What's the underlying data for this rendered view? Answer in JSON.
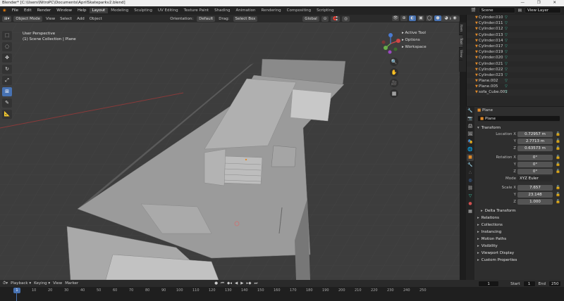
{
  "titlebar": {
    "title": "Blender* [C:\\Users\\NitroPC\\Documents\\AprilSkateparkv2.blend]",
    "controls": "— ❐ ✕"
  },
  "menu": {
    "items": [
      "File",
      "Edit",
      "Render",
      "Window",
      "Help"
    ],
    "workspaces": [
      "Layout",
      "Modeling",
      "Sculpting",
      "UV Editing",
      "Texture Paint",
      "Shading",
      "Animation",
      "Rendering",
      "Compositing",
      "Scripting"
    ],
    "scene": "Scene",
    "view_layer": "View Layer"
  },
  "viewport_header": {
    "mode": "Object Mode",
    "view": "View",
    "select": "Select",
    "add": "Add",
    "object": "Object",
    "orientation_label": "Orientation:",
    "orientation": "Default",
    "drag_label": "Drag:",
    "drag": "Select Box",
    "transform": "Global",
    "options": "Options"
  },
  "viewport": {
    "line1": "User Perspective",
    "line2": "(1) Scene Collection | Plane",
    "npanel": [
      "Active Tool",
      "Options",
      "Workspace"
    ],
    "sidetabs": [
      "Item",
      "Tool",
      "View"
    ]
  },
  "toolbar": {
    "icons": [
      "⬚",
      "◌",
      "✥",
      "↻",
      "⤢",
      "⊞",
      "✎",
      "📐"
    ]
  },
  "nav_icons": [
    "🔍",
    "✋",
    "🎥",
    "▦"
  ],
  "outliner": {
    "rows": [
      "Cylinder.010",
      "Cylinder.011",
      "Cylinder.012",
      "Cylinder.013",
      "Cylinder.014",
      "Cylinder.017",
      "Cylinder.019",
      "Cylinder.020",
      "Cylinder.021",
      "Cylinder.022",
      "Cylinder.023",
      "Plane.002",
      "Plane.005",
      "sofa_Cube.001"
    ],
    "tri_icon": "▼",
    "mesh_icon": "▽"
  },
  "properties": {
    "object_name": "Plane",
    "data_name": "Plane",
    "transform_header": "Transform",
    "location": {
      "label": "Location X",
      "x": "0.72957 m",
      "y": "2.7713 m",
      "z": "0.63573 m"
    },
    "rotation": {
      "label": "Rotation X",
      "x": "0°",
      "y": "0°",
      "z": "0°"
    },
    "mode_label": "Mode",
    "mode": "XYZ Euler",
    "scale": {
      "label": "Scale X",
      "x": "7.657",
      "y": "23.148",
      "z": "1.000"
    },
    "axis_y": "Y",
    "axis_z": "Z",
    "delta": "Delta Transform",
    "sections": [
      "Relations",
      "Collections",
      "Instancing",
      "Motion Paths",
      "Visibility",
      "Viewport Display",
      "Custom Properties"
    ]
  },
  "timeline": {
    "playback": "Playback",
    "keying": "Keying",
    "view": "View",
    "marker": "Marker",
    "current_frame": "1",
    "start_label": "Start",
    "start": "1",
    "end_label": "End",
    "end": "250",
    "ruler": [
      "1",
      "10",
      "20",
      "30",
      "40",
      "50",
      "60",
      "70",
      "80",
      "90",
      "100",
      "110",
      "120",
      "130",
      "140",
      "150",
      "160",
      "170",
      "180",
      "190",
      "200",
      "210",
      "220",
      "230",
      "240",
      "250"
    ]
  }
}
